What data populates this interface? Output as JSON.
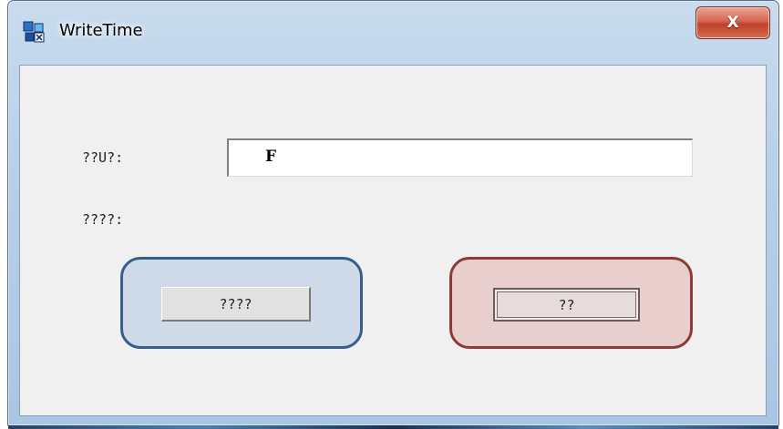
{
  "window": {
    "title": "WriteTime",
    "close_symbol": "X",
    "icons": {
      "app": "app-icon",
      "close": "close-icon"
    }
  },
  "form": {
    "field_label": "??U?:",
    "field_value": "F",
    "status_label": "????:"
  },
  "buttons": {
    "read_label": "????",
    "write_label": "??"
  },
  "highlights": {
    "read_color": "#385d8a",
    "write_color": "#8c3a3a"
  }
}
